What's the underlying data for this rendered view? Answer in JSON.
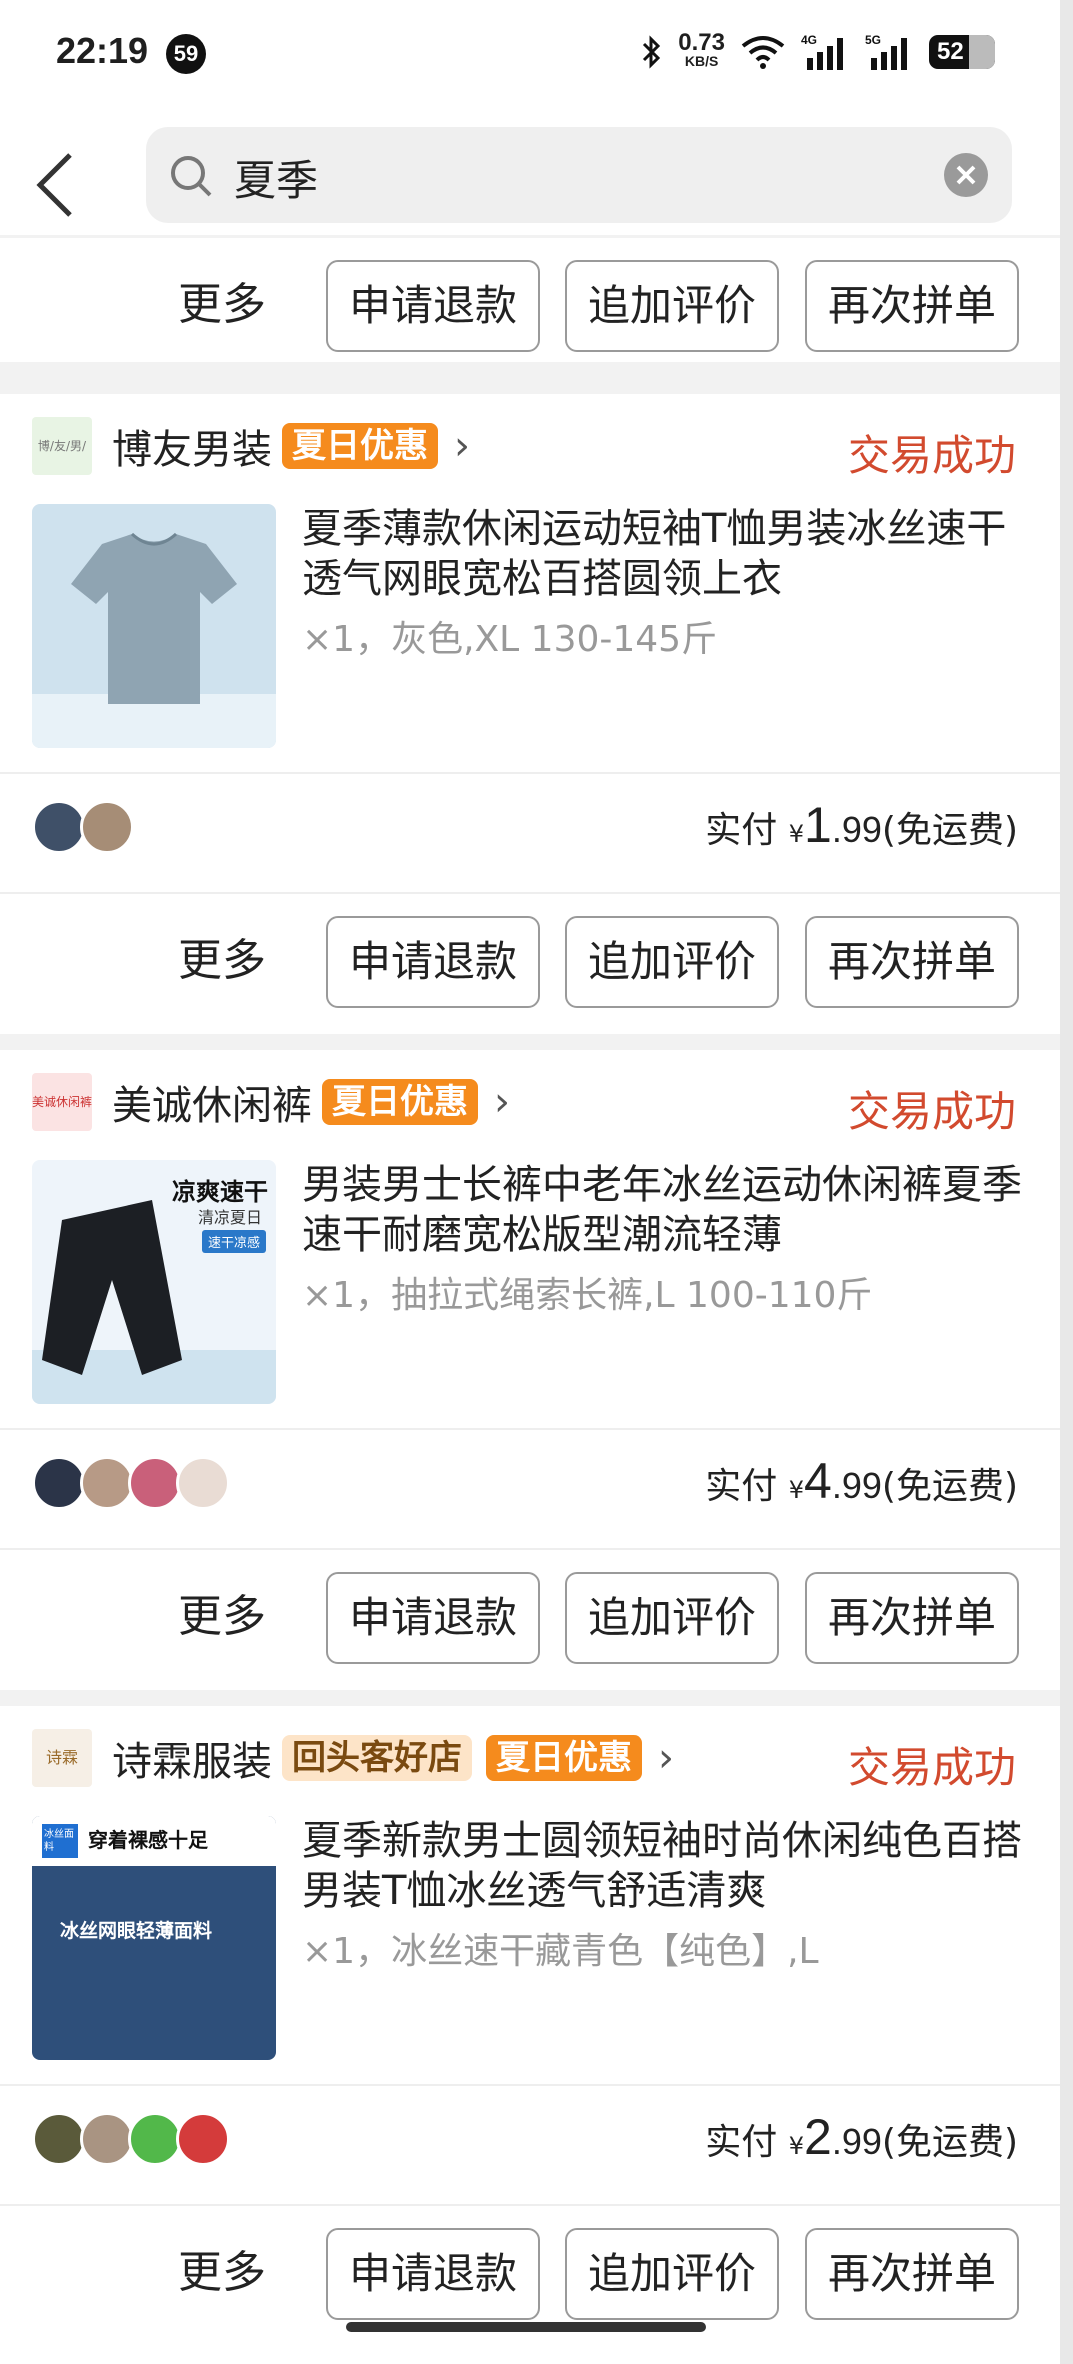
{
  "status_bar": {
    "time": "22:19",
    "badge": "59",
    "net_speed": "0.73",
    "net_unit": "KB/S",
    "battery": "52"
  },
  "search": {
    "query": "夏季"
  },
  "actions": {
    "more": "更多",
    "refund": "申请退款",
    "add_review": "追加评价",
    "reorder": "再次拼单"
  },
  "orders": [
    {
      "shop": "博友男装",
      "shop_logo_text": "博/友/男/装",
      "tags": [
        "夏日优惠"
      ],
      "status": "交易成功",
      "title": "夏季薄款休闲运动短袖T恤男装冰丝速干透气网眼宽松百搭圆领上衣",
      "spec": "×1，灰色,XL 130-145斤",
      "price_label": "实付",
      "price_symbol": "¥",
      "price_int": "1",
      "price_dec": ".99",
      "shipping": "(免运费)"
    },
    {
      "shop": "美诚休闲裤",
      "shop_logo_text": "美诚休闲裤",
      "tags": [
        "夏日优惠"
      ],
      "status": "交易成功",
      "title": "男装男士长裤中老年冰丝运动休闲裤夏季速干耐磨宽松版型潮流轻薄",
      "spec": "×1，抽拉式绳索长裤,L 100-110斤",
      "thumb_text": [
        "凉爽速干",
        "清凉夏日",
        "速干凉感"
      ],
      "price_label": "实付",
      "price_symbol": "¥",
      "price_int": "4",
      "price_dec": ".99",
      "shipping": "(免运费)"
    },
    {
      "shop": "诗霖服装",
      "shop_logo_text": "诗霖",
      "tags": [
        "回头客好店",
        "夏日优惠"
      ],
      "status": "交易成功",
      "title": "夏季新款男士圆领短袖时尚休闲纯色百搭男装T恤冰丝透气舒适清爽",
      "spec": "×1，冰丝速干藏青色【纯色】,L",
      "thumb_text": [
        "冰丝面料",
        "穿着裸感十足",
        "冰丝网眼轻薄面料"
      ],
      "price_label": "实付",
      "price_symbol": "¥",
      "price_int": "2",
      "price_dec": ".99",
      "shipping": "(免运费)"
    }
  ],
  "colors": {
    "accent_orange": "#f58b1d",
    "success_red": "#d24a2e"
  }
}
